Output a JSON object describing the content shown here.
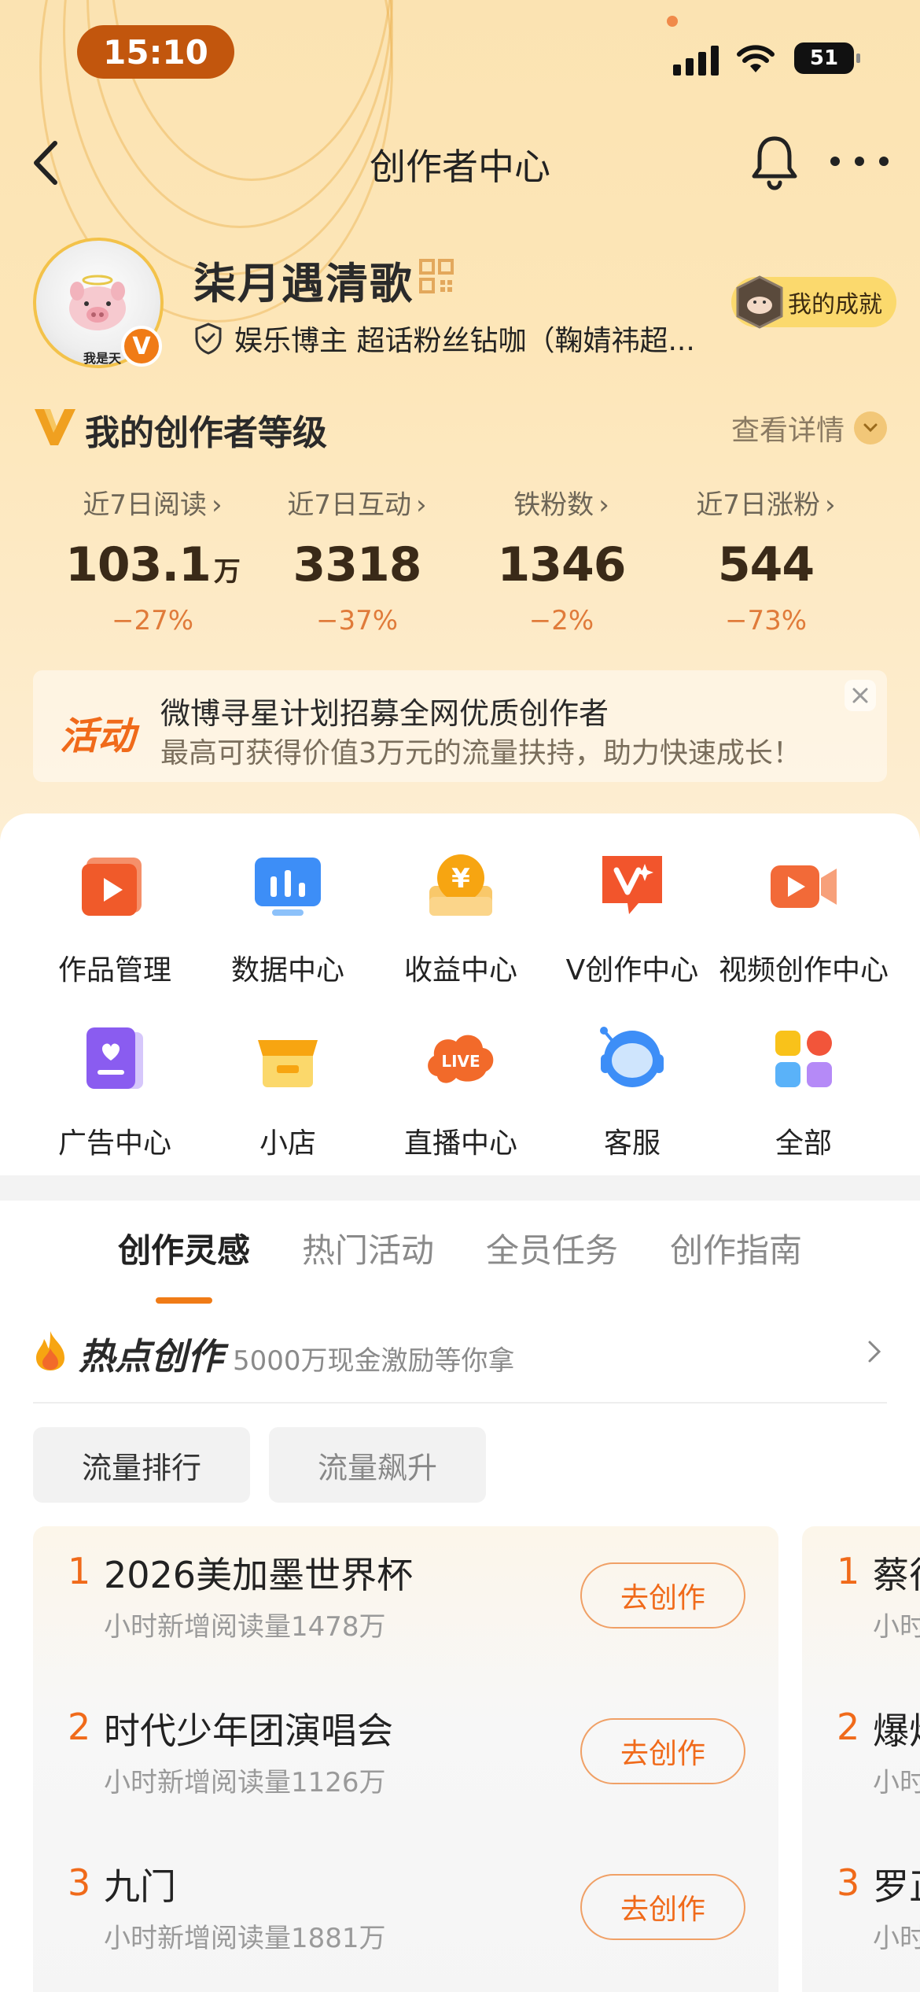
{
  "status_bar": {
    "time": "15:10",
    "battery": "51"
  },
  "nav": {
    "title": "创作者中心"
  },
  "profile": {
    "name": "柒月遇清歌",
    "description": "娱乐博主 超话粉丝钻咖（鞠婧祎超...",
    "avatar_text": "我是天",
    "verified_badge": "V",
    "achievement": "我的成就"
  },
  "level": {
    "title": "我的创作者等级",
    "detail_link": "查看详情"
  },
  "stats": [
    {
      "label": "近7日阅读",
      "value": "103.1",
      "unit": "万",
      "change": "−27%"
    },
    {
      "label": "近7日互动",
      "value": "3318",
      "unit": "",
      "change": "−37%"
    },
    {
      "label": "铁粉数",
      "value": "1346",
      "unit": "",
      "change": "−2%"
    },
    {
      "label": "近7日涨粉",
      "value": "544",
      "unit": "",
      "change": "−73%"
    }
  ],
  "activity": {
    "tag": "活动",
    "title": "微博寻星计划招募全网优质创作者",
    "subtitle": "最高可获得价值3万元的流量扶持，助力快速成长！"
  },
  "tools": [
    {
      "label": "作品管理",
      "icon": "works-icon"
    },
    {
      "label": "数据中心",
      "icon": "data-icon"
    },
    {
      "label": "收益中心",
      "icon": "income-icon"
    },
    {
      "label": "V创作中心",
      "icon": "v-create-icon"
    },
    {
      "label": "视频创作中心",
      "icon": "video-icon"
    },
    {
      "label": "广告中心",
      "icon": "ad-icon"
    },
    {
      "label": "小店",
      "icon": "shop-icon"
    },
    {
      "label": "直播中心",
      "icon": "live-icon"
    },
    {
      "label": "客服",
      "icon": "service-icon"
    },
    {
      "label": "全部",
      "icon": "all-icon"
    }
  ],
  "tabs": [
    {
      "label": "创作灵感",
      "active": true
    },
    {
      "label": "热门活动",
      "active": false
    },
    {
      "label": "全员任务",
      "active": false
    },
    {
      "label": "创作指南",
      "active": false
    }
  ],
  "hot": {
    "title": "热点创作",
    "subtitle": "5000万现金激励等你拿"
  },
  "chips": [
    {
      "label": "流量排行",
      "selected": true
    },
    {
      "label": "流量飙升",
      "selected": false
    }
  ],
  "ranking": [
    {
      "rank": "1",
      "title": "2026美加墨世界杯",
      "sub": "小时新增阅读量1478万",
      "button": "去创作"
    },
    {
      "rank": "2",
      "title": "时代少年团演唱会",
      "sub": "小时新增阅读量1126万",
      "button": "去创作"
    },
    {
      "rank": "3",
      "title": "九门",
      "sub": "小时新增阅读量1881万",
      "button": "去创作"
    }
  ],
  "ranking_next": [
    {
      "rank": "1",
      "title": "蔡徉",
      "sub": "小时"
    },
    {
      "rank": "2",
      "title": "爆炸",
      "sub": "小时"
    },
    {
      "rank": "3",
      "title": "罗正",
      "sub": "小时"
    }
  ],
  "colors": {
    "accent": "#f06a1a",
    "header_bg": "#fbe3b2",
    "time_pill": "#c2560d"
  }
}
